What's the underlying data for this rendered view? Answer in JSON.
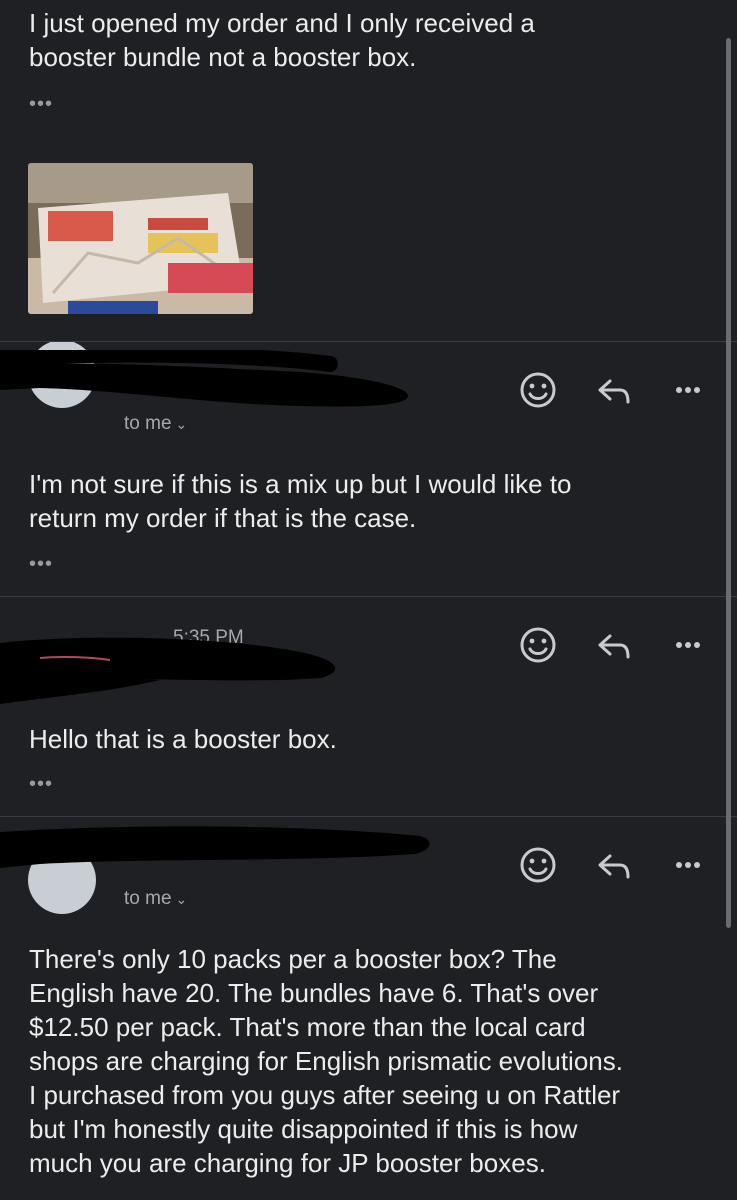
{
  "messages": [
    {
      "body": "I just opened my order and I only received a booster bundle not a booster box.",
      "body_lines": [
        "I just opened my order and I only received a",
        "booster bundle not a booster box."
      ],
      "more": "•••"
    },
    {
      "recipient": "to me",
      "body_lines": [
        "I'm not sure if this is a mix up but I would like to",
        "return my order if that is the case."
      ],
      "more": "•••"
    },
    {
      "time": "5:35 PM",
      "body_lines": [
        "Hello that is a booster box."
      ],
      "more": "•••"
    },
    {
      "recipient": "to me",
      "body_lines": [
        "There's only 10 packs per a booster box? The",
        "English have 20. The bundles have 6. That's over",
        "$12.50 per pack. That's more than the local card",
        "shops are charging for English prismatic evolutions.",
        "I purchased from you guys after seeing u on Rattler",
        "but I'm honestly quite disappointed if this is how",
        "much you are charging for JP booster boxes."
      ]
    }
  ],
  "actions": {
    "react_icon": "smiley-face-icon",
    "reply_icon": "reply-arrow-icon",
    "more_icon": "more-horizontal-icon"
  },
  "colors": {
    "background": "#1f2024",
    "text": "#ececec",
    "muted": "#a7a8ad",
    "divider": "#3a3b40"
  }
}
